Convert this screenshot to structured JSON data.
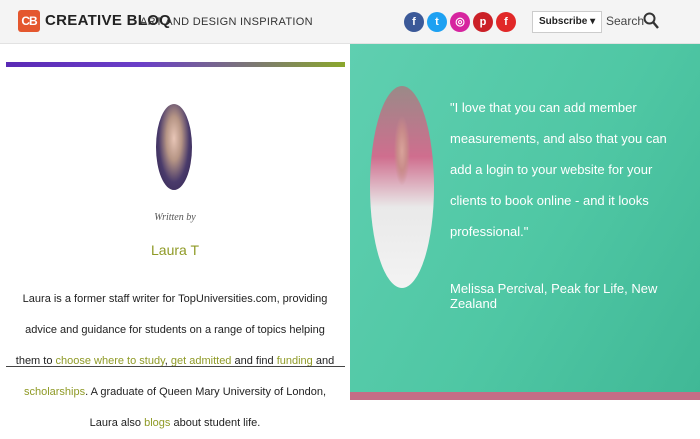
{
  "header": {
    "logo_mark": "CB",
    "brand_name": "CREATIVE BLOQ",
    "tagline": "ART AND DESIGN INSPIRATION",
    "social": [
      {
        "name": "facebook-icon",
        "glyph": "f",
        "color": "#3b5998"
      },
      {
        "name": "twitter-icon",
        "glyph": "t",
        "color": "#1da1f2"
      },
      {
        "name": "instagram-icon",
        "glyph": "◎",
        "color": "#d6249f"
      },
      {
        "name": "pinterest-icon",
        "glyph": "p",
        "color": "#cb2027"
      },
      {
        "name": "flipboard-icon",
        "glyph": "f",
        "color": "#e12828"
      }
    ],
    "subscribe_label": "Subscribe ▾",
    "search_label": "Search"
  },
  "author_card": {
    "written_by": "Written by",
    "name": "Laura T",
    "bio": {
      "part1": "Laura is a former staff writer for TopUniversities.com, providing advice and guidance for students on a range of topics helping them to ",
      "link1": "choose where to study",
      "sep1": ", ",
      "link2": "get admitted",
      "part2": " and find ",
      "link3": "funding",
      "part3": " and ",
      "link4": "scholarships",
      "part4": ". A graduate of Queen Mary University of London, Laura also ",
      "link5": "blogs",
      "part5": " about student life."
    }
  },
  "testimonial": {
    "quote": "\"I love that you can add member measurements, and also that you can add a login to your website for your clients to book online - and it looks professional.\"",
    "attribution": "Melissa Percival, Peak for Life, New Zealand"
  }
}
